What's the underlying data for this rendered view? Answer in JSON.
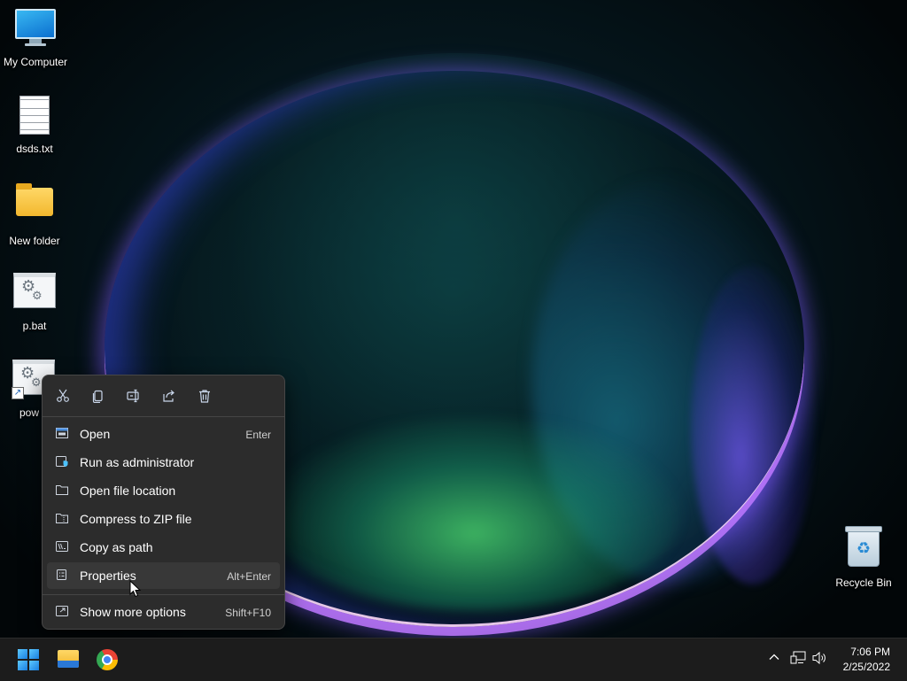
{
  "desktop": {
    "icons": [
      {
        "label": "My Computer",
        "icon": "computer-icon"
      },
      {
        "label": "dsds.txt",
        "icon": "text-file-icon"
      },
      {
        "label": "New folder",
        "icon": "folder-icon"
      },
      {
        "label": "p.bat",
        "icon": "batch-file-icon"
      },
      {
        "label": "pow",
        "icon": "batch-shortcut-icon"
      }
    ],
    "recycle_bin": {
      "label": "Recycle Bin",
      "icon": "recycle-bin-icon"
    }
  },
  "context_menu": {
    "toolbar": [
      {
        "name": "cut",
        "icon": "scissors-icon"
      },
      {
        "name": "copy",
        "icon": "copy-icon"
      },
      {
        "name": "rename",
        "icon": "rename-icon"
      },
      {
        "name": "share",
        "icon": "share-icon"
      },
      {
        "name": "delete",
        "icon": "trash-icon"
      }
    ],
    "items": [
      {
        "label": "Open",
        "shortcut": "Enter",
        "icon": "open-window-icon"
      },
      {
        "label": "Run as administrator",
        "shortcut": "",
        "icon": "shield-icon"
      },
      {
        "label": "Open file location",
        "shortcut": "",
        "icon": "folder-outline-icon"
      },
      {
        "label": "Compress to ZIP file",
        "shortcut": "",
        "icon": "zip-folder-icon"
      },
      {
        "label": "Copy as path",
        "shortcut": "",
        "icon": "path-icon"
      },
      {
        "label": "Properties",
        "shortcut": "Alt+Enter",
        "icon": "properties-icon"
      }
    ],
    "more": {
      "label": "Show more options",
      "shortcut": "Shift+F10",
      "icon": "expand-icon"
    }
  },
  "taskbar": {
    "apps": [
      {
        "name": "Start",
        "icon": "windows-start-icon"
      },
      {
        "name": "File Explorer",
        "icon": "file-explorer-icon"
      },
      {
        "name": "Google Chrome",
        "icon": "chrome-icon"
      }
    ],
    "tray": {
      "time": "7:06 PM",
      "date": "2/25/2022"
    }
  },
  "colors": {
    "menu_bg": "#2c2c2c",
    "menu_hover": "#383838",
    "taskbar_bg": "#1c1c1c",
    "accent": "#4cc2ff"
  }
}
